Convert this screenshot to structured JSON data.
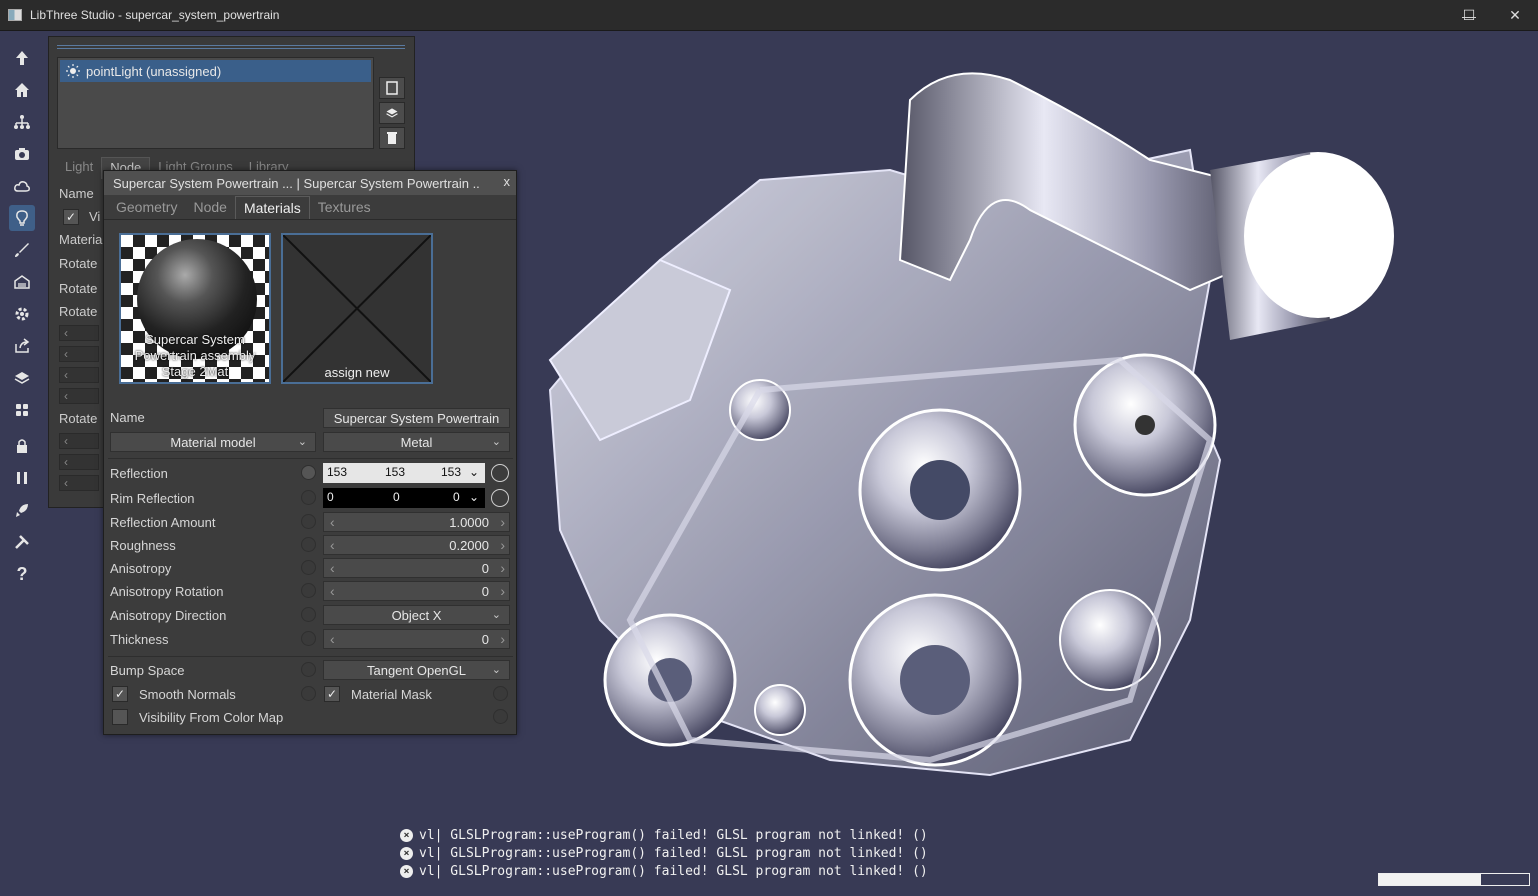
{
  "window": {
    "title": "LibThree Studio - supercar_system_powertrain"
  },
  "toolbar": {
    "icons": [
      "up-arrow-icon",
      "home-icon",
      "hierarchy-icon",
      "camera-icon",
      "cloud-icon",
      "lightbulb-icon",
      "brush-icon",
      "material-icon",
      "gear-icon",
      "export-icon",
      "layers-icon",
      "grid-icon",
      "lock-icon",
      "pause-icon",
      "rocket-icon",
      "tools-icon",
      "help-icon"
    ],
    "help_label": "?"
  },
  "light_panel": {
    "items": [
      "pointLight (unassigned)"
    ],
    "tabs": [
      "Light",
      "Node",
      "Light Groups",
      "Library"
    ],
    "selected_tab": "Node",
    "labels": {
      "name": "Name",
      "visible": "Vi",
      "material": "Materia",
      "rotate1": "Rotate",
      "rotate2": "Rotate",
      "rotate3": "Rotate",
      "rotate4": "Rotate"
    }
  },
  "material_panel": {
    "header": "Supercar System Powertrain ... | Supercar System Powertrain ..",
    "close": "x",
    "tabs": [
      "Geometry",
      "Node",
      "Materials",
      "Textures"
    ],
    "selected_tab": "Materials",
    "thumb1_caption": "Supercar System Powertrain assembly Stage 2Mat",
    "thumb2_caption": "assign new",
    "name_label": "Name",
    "name_value": "Supercar System Powertrain",
    "material_model_label": "Material model",
    "material_type": "Metal",
    "reflection": {
      "label": "Reflection",
      "r": "153",
      "g": "153",
      "b": "153",
      "color": "#999999"
    },
    "rim_reflection": {
      "label": "Rim Reflection",
      "r": "0",
      "g": "0",
      "b": "0",
      "color": "#000000"
    },
    "reflection_amount": {
      "label": "Reflection Amount",
      "value": "1.0000"
    },
    "roughness": {
      "label": "Roughness",
      "value": "0.2000"
    },
    "anisotropy": {
      "label": "Anisotropy",
      "value": "0"
    },
    "anisotropy_rotation": {
      "label": "Anisotropy Rotation",
      "value": "0"
    },
    "anisotropy_direction": {
      "label": "Anisotropy Direction",
      "value": "Object X"
    },
    "thickness": {
      "label": "Thickness",
      "value": "0"
    },
    "bump_space": {
      "label": "Bump Space",
      "value": "Tangent OpenGL"
    },
    "smooth_normals": {
      "label": "Smooth Normals",
      "checked": true
    },
    "material_mask": {
      "label": "Material Mask",
      "checked": true
    },
    "visibility_from_color_map": {
      "label": "Visibility From Color Map",
      "checked": false
    },
    "check_mark": "✓"
  },
  "log": {
    "lines": [
      "vl| GLSLProgram::useProgram() failed! GLSL program not linked! ()",
      "vl| GLSLProgram::useProgram() failed! GLSL program not linked! ()",
      "vl| GLSLProgram::useProgram() failed! GLSL program not linked! ()"
    ],
    "icon": "error-icon"
  },
  "progress": {
    "fraction": 0.68
  },
  "colors": {
    "viewport_bg": "#383a55",
    "accent": "#3a5f8a",
    "panel": "#3c3c3c"
  }
}
